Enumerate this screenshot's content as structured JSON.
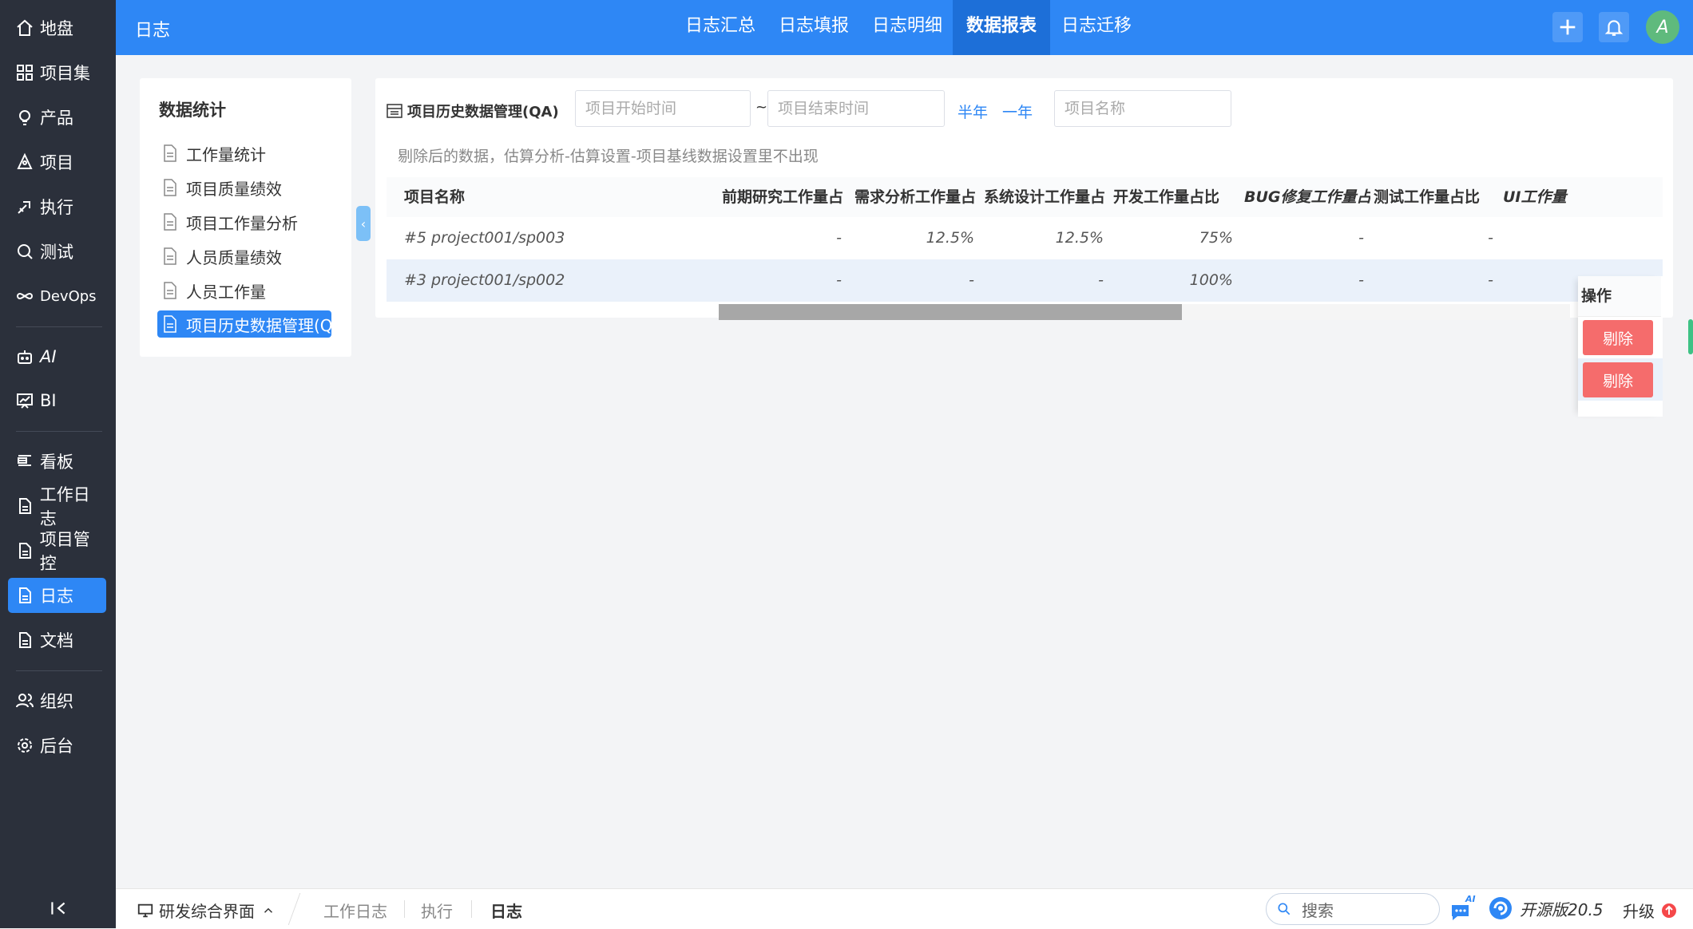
{
  "sidebar": {
    "items": [
      {
        "label": "地盘",
        "icon": "home-icon"
      },
      {
        "label": "项目集",
        "icon": "grid-icon"
      },
      {
        "label": "产品",
        "icon": "bulb-icon"
      },
      {
        "label": "项目",
        "icon": "project-icon"
      },
      {
        "label": "执行",
        "icon": "execute-icon"
      },
      {
        "label": "测试",
        "icon": "test-icon"
      },
      {
        "label": "DevOps",
        "icon": "infinity-icon"
      },
      {
        "label": "AI",
        "icon": "robot-icon"
      },
      {
        "label": "BI",
        "icon": "chart-icon"
      },
      {
        "label": "看板",
        "icon": "kanban-icon"
      },
      {
        "label": "工作日志",
        "icon": "document-icon"
      },
      {
        "label": "项目管控",
        "icon": "document-icon"
      },
      {
        "label": "日志",
        "icon": "document-icon",
        "active": true
      },
      {
        "label": "文档",
        "icon": "document-icon"
      },
      {
        "label": "组织",
        "icon": "users-icon"
      },
      {
        "label": "后台",
        "icon": "gear-icon"
      }
    ]
  },
  "topbar": {
    "title": "日志",
    "tabs": [
      {
        "label": "日志汇总"
      },
      {
        "label": "日志填报"
      },
      {
        "label": "日志明细"
      },
      {
        "label": "数据报表",
        "active": true
      },
      {
        "label": "日志迁移"
      }
    ],
    "avatar": "A"
  },
  "leftpanel": {
    "title": "数据统计",
    "items": [
      {
        "label": "工作量统计"
      },
      {
        "label": "项目质量绩效"
      },
      {
        "label": "项目工作量分析"
      },
      {
        "label": "人员质量绩效"
      },
      {
        "label": "人员工作量"
      },
      {
        "label": "项目历史数据管理(QA",
        "active": true
      }
    ]
  },
  "main": {
    "title": "项目历史数据管理(QA)",
    "start_placeholder": "项目开始时间",
    "tilde": "~",
    "end_placeholder": "项目结束时间",
    "quick_half": "半年",
    "quick_year": "一年",
    "name_placeholder": "项目名称",
    "note": "剔除后的数据，估算分析-估算设置-项目基线数据设置里不出现",
    "columns": [
      "项目名称",
      "前期研究工作量占",
      "需求分析工作量占",
      "系统设计工作量占",
      "开发工作量占比",
      "BUG修复工作量占",
      "测试工作量占比",
      "UI工作量",
      "操作"
    ],
    "rows": [
      {
        "cells": [
          "#5 project001/sp003",
          "-",
          "12.5%",
          "12.5%",
          "75%",
          "-",
          "-"
        ],
        "action": "剔除"
      },
      {
        "cells": [
          "#3 project001/sp002",
          "-",
          "-",
          "-",
          "100%",
          "-",
          "-"
        ],
        "action": "剔除"
      }
    ]
  },
  "bottombar": {
    "crumb_root": "研发综合界面",
    "crumbs": [
      "工作日志",
      "执行"
    ],
    "current": "日志",
    "search": "搜索",
    "ai_badge": "AI",
    "version": "开源版20.5",
    "upgrade": "升级"
  }
}
